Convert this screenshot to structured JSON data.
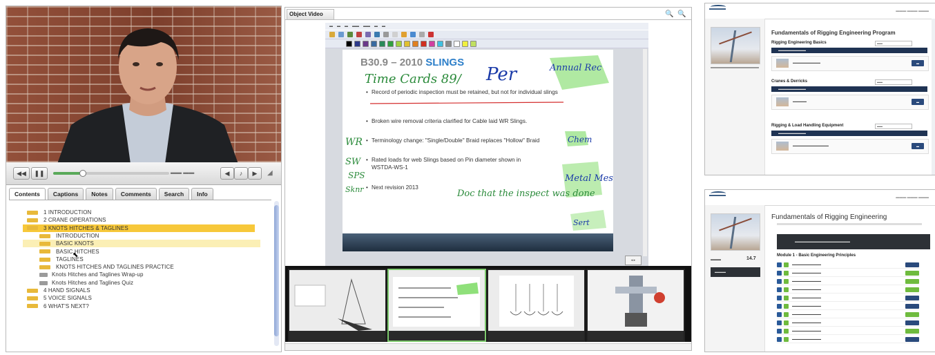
{
  "player": {
    "tabs": [
      "Contents",
      "Captions",
      "Notes",
      "Comments",
      "Search",
      "Info"
    ],
    "progress_fraction": 0.25,
    "toc": [
      {
        "label": "1 INTRODUCTION",
        "level": 0,
        "kind": "folder"
      },
      {
        "label": "2 CRANE OPERATIONS",
        "level": 0,
        "kind": "folder"
      },
      {
        "label": "3 KNOTS HITCHES & TAGLINES",
        "level": 0,
        "kind": "folder",
        "state": "open"
      },
      {
        "label": "INTRODUCTION",
        "level": 1,
        "kind": "folder"
      },
      {
        "label": "BASIC KNOTS",
        "level": 1,
        "kind": "folder",
        "state": "current"
      },
      {
        "label": "BASIC HITCHES",
        "level": 1,
        "kind": "folder"
      },
      {
        "label": "TAGLINES",
        "level": 1,
        "kind": "folder"
      },
      {
        "label": "KNOTS HITCHES AND TAGLINES PRACTICE",
        "level": 1,
        "kind": "folder"
      },
      {
        "label": "Knots Hitches and Taglines Wrap-up",
        "level": 1,
        "kind": "doc"
      },
      {
        "label": "Knots Hitches and Taglines Quiz",
        "level": 1,
        "kind": "doc"
      },
      {
        "label": "4 HAND SIGNALS",
        "level": 0,
        "kind": "folder"
      },
      {
        "label": "5 VOICE SIGNALS",
        "level": 0,
        "kind": "folder"
      },
      {
        "label": "6 WHAT'S NEXT?",
        "level": 0,
        "kind": "folder"
      }
    ]
  },
  "object_video": {
    "tab_label": "Object Video",
    "slide": {
      "title_main": "B30.9 – 2010",
      "title_accent": "SLINGS",
      "bullets": [
        "Record of periodic inspection must be retained, but not for individual slings",
        "Broken wire removal criteria clarified for Cable laid WR Slings.",
        "Terminology change: \"Single/Double\" Braid replaces \"Hollow\" Braid",
        "Rated loads for web Slings based on Pin diameter shown in WSTDA-WS-1",
        "Next revision 2013"
      ],
      "handwriting": [
        "Time Cards 89/",
        "Per",
        "Annual Rec",
        "Chem",
        "Metal Mesh",
        "WR",
        "SW",
        "SPS",
        "Sknr",
        "Doc that the inspect was done",
        "Sert"
      ]
    }
  },
  "portal_top": {
    "title": "Fundamentals of Rigging Engineering Program",
    "sections": [
      {
        "title": "Rigging Engineering Basics"
      },
      {
        "title": "Cranes & Derricks"
      },
      {
        "title": "Rigging & Load Handling Equipment"
      }
    ]
  },
  "portal_bottom": {
    "title": "Fundamentals of Rigging Engineering",
    "module_title": "Module 1 - Basic Engineering Principles",
    "side_value": "14.7"
  },
  "colors": {
    "accent_blue": "#2d7fc9",
    "toc_highlight": "#f7c83a",
    "toc_current": "#fbefb5",
    "navy": "#1f3353",
    "green": "#6fbb3e"
  }
}
